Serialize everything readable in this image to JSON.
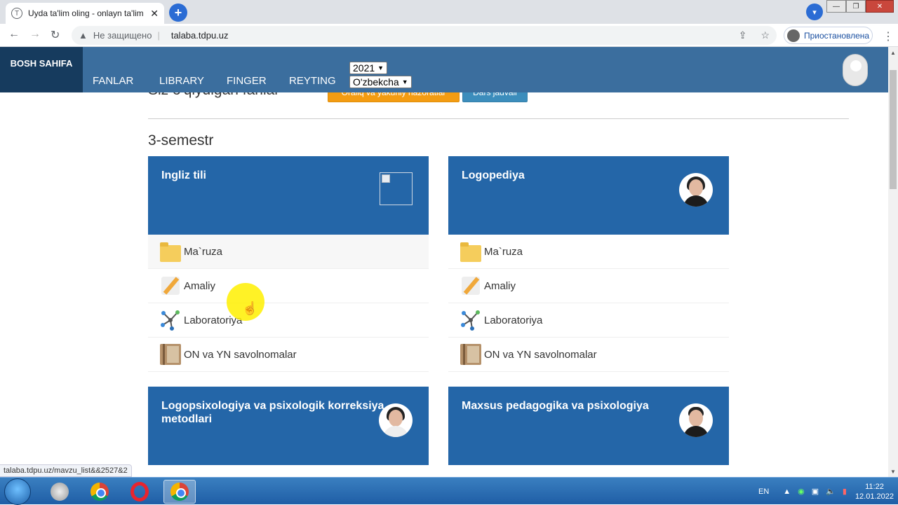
{
  "browser": {
    "tab_title": "Uyda ta'lim oling - onlayn ta'lim",
    "tab_favicon_letter": "T",
    "security_label": "Не защищено",
    "url": "talaba.tdpu.uz",
    "profile_label": "Приостановлена",
    "status_url": "talaba.tdpu.uz/mavzu_list&&2527&2"
  },
  "navbar": {
    "brand": "BOSH SAHIFA",
    "links": [
      "FANLAR",
      "LIBRARY",
      "FINGER",
      "REYTING"
    ],
    "year_select": "2021",
    "lang_select": "O'zbekcha"
  },
  "page": {
    "partial_title": "Siz o'qiydigan fanlar",
    "btn_exams": "Oraliq va yakuniy nazoratlar",
    "btn_schedule": "Dars jadvali",
    "semester": "3-semestr"
  },
  "subjects": [
    {
      "title": "Ingliz tili",
      "items": [
        "Ma`ruza",
        "Amaliy",
        "Laboratoriya",
        "ON va YN savolnomalar"
      ]
    },
    {
      "title": "Logopediya",
      "items": [
        "Ma`ruza",
        "Amaliy",
        "Laboratoriya",
        "ON va YN savolnomalar"
      ]
    },
    {
      "title": "Logopsixologiya va psixologik korreksiya metodlari"
    },
    {
      "title": "Maxsus pedagogika va psixologiya"
    }
  ],
  "taskbar": {
    "lang": "EN",
    "time": "11:22",
    "date": "12.01.2022"
  }
}
